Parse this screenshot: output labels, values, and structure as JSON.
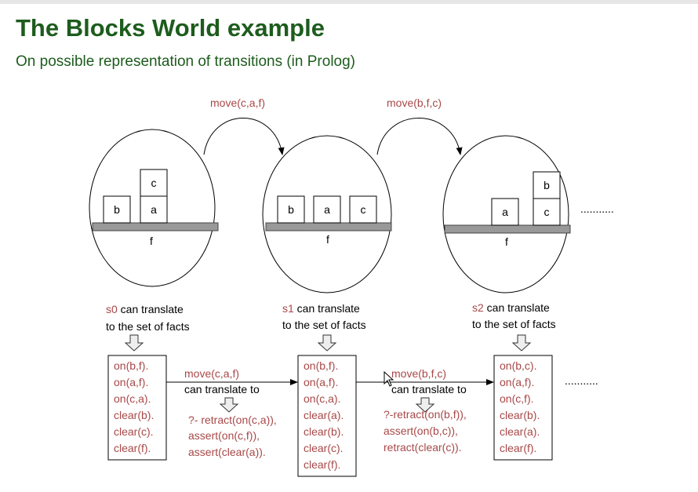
{
  "header": {
    "title": "The Blocks World example",
    "subtitle": "On possible representation of transitions (in Prolog)"
  },
  "moves": [
    "move(c,a,f)",
    "move(b,f,c)"
  ],
  "table_label": "f",
  "ellipsis": "...........",
  "states": [
    {
      "name": "s0",
      "blocks": [
        "b",
        "a",
        "c"
      ],
      "translate_line1": " can translate",
      "translate_line2": "to the set of facts",
      "facts": [
        "on(b,f).",
        "on(a,f).",
        "on(c,a).",
        "clear(b).",
        "clear(c).",
        "clear(f)."
      ]
    },
    {
      "name": "s1",
      "blocks": [
        "b",
        "a",
        "c"
      ],
      "translate_line1": " can translate",
      "translate_line2": "to the set of facts",
      "facts": [
        "on(b,f).",
        "on(a,f).",
        "on(c,a).",
        "clear(a).",
        "clear(b).",
        "clear(c).",
        "clear(f)."
      ]
    },
    {
      "name": "s2",
      "blocks": [
        "a",
        "c",
        "b"
      ],
      "translate_line1": " can translate",
      "translate_line2": "to the set of facts",
      "facts": [
        "on(b,c).",
        "on(a,f).",
        "on(c,f).",
        "clear(b).",
        "clear(a).",
        "clear(f)."
      ]
    }
  ],
  "transitions": [
    {
      "move": "move(c,a,f)",
      "caption": "can translate to",
      "code": [
        "?- retract(on(c,a)),",
        "assert(on(c,f)),",
        "assert(clear(a))."
      ]
    },
    {
      "move": "move(b,f,c)",
      "caption": "can translate to",
      "code": [
        "?-retract(on(b,f)),",
        "assert(on(b,c)),",
        "retract(clear(c))."
      ]
    }
  ]
}
